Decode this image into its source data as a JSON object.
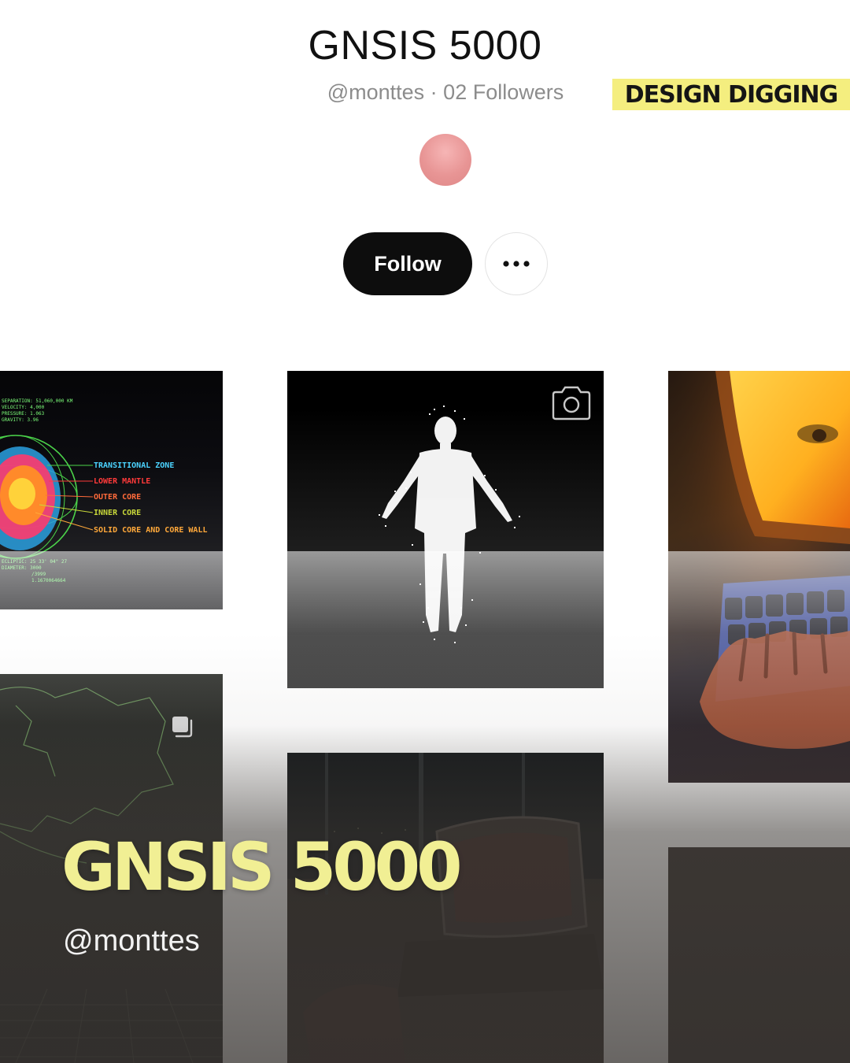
{
  "profile": {
    "title": "GNSIS 5000",
    "meta": "@monttes · 02 Followers",
    "avatar_color": "#e89595"
  },
  "brand": {
    "label": "DESIGN DIGGING",
    "color": "#f4ee7f"
  },
  "actions": {
    "follow_label": "Follow",
    "more_icon": "more-horizontal-icon"
  },
  "tile_1": {
    "readout_top": [
      "SEPARATION: 51,060,000 KM",
      "VELOCITY: 4,000",
      "PRESSURE: 1.063",
      "GRAVITY: 3.96"
    ],
    "labels": [
      "TRANSITIONAL ZONE",
      "LOWER MANTLE",
      "OUTER CORE",
      "INNER CORE",
      "SOLID CORE AND CORE WALL"
    ],
    "readout_bottom": [
      "ECLIPTIC: 25 33' 04\" 27",
      "DIAMETER: 3000",
      "/3999",
      "1.1670064664"
    ]
  },
  "grid": {
    "tiles": [
      {
        "id": "tile-1",
        "subject": "planet-core-diagram"
      },
      {
        "id": "tile-2",
        "subject": "point-cloud-figure",
        "icon": "camera-icon"
      },
      {
        "id": "tile-3",
        "subject": "terminal-typing-photo"
      },
      {
        "id": "tile-4",
        "subject": "wireframe-map",
        "icon": "multiple-images-icon"
      },
      {
        "id": "tile-5",
        "subject": "retro-console-room"
      },
      {
        "id": "tile-6",
        "subject": "dark-placeholder"
      }
    ]
  },
  "footer": {
    "title": "GNSIS 5000",
    "handle": "@monttes",
    "title_color": "#f1ef94"
  }
}
